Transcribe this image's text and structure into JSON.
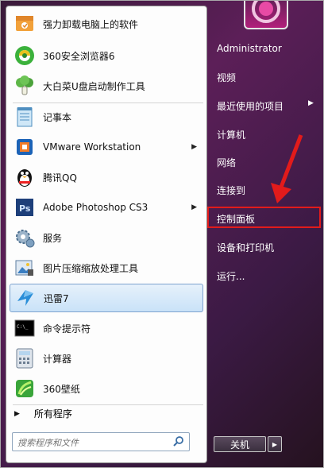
{
  "left": {
    "programs": [
      {
        "label": "强力卸载电脑上的软件",
        "icon": "uninstall-box-icon"
      },
      {
        "label": "360安全浏览器6",
        "icon": "360-browser-icon"
      },
      {
        "label": "大白菜U盘启动制作工具",
        "icon": "cabbage-icon"
      },
      {
        "label": "记事本",
        "icon": "notepad-icon"
      },
      {
        "label": "VMware Workstation",
        "icon": "vmware-icon"
      },
      {
        "label": "腾讯QQ",
        "icon": "qq-penguin-icon"
      },
      {
        "label": "Adobe Photoshop CS3",
        "icon": "photoshop-icon"
      },
      {
        "label": "服务",
        "icon": "services-gear-icon"
      },
      {
        "label": "图片压缩缩放处理工具",
        "icon": "image-tool-icon"
      },
      {
        "label": "迅雷7",
        "icon": "thunder-bird-icon"
      },
      {
        "label": "命令提示符",
        "icon": "cmd-icon"
      },
      {
        "label": "计算器",
        "icon": "calculator-icon"
      },
      {
        "label": "360壁纸",
        "icon": "wallpaper-icon"
      }
    ],
    "all_programs": "所有程序",
    "search_placeholder": "搜索程序和文件"
  },
  "right": {
    "items": [
      "Administrator",
      "视频",
      "最近使用的项目",
      "计算机",
      "网络",
      "连接到",
      "控制面板",
      "设备和打印机",
      "运行..."
    ],
    "shutdown_label": "关机"
  },
  "colors": {
    "highlight_box": "#e21b1b",
    "arrow": "#e21b1b",
    "hover_bg": "#c9e2f8"
  }
}
